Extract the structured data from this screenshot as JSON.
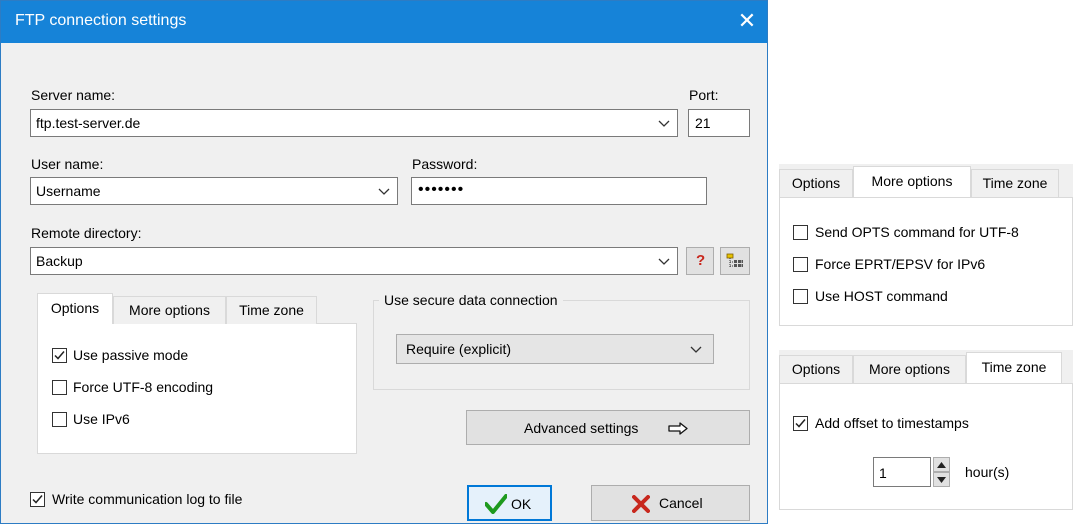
{
  "dialog": {
    "title": "FTP connection settings",
    "close_glyph": "✕",
    "server_label": "Server name:",
    "server_value": "ftp.test-server.de",
    "port_label": "Port:",
    "port_value": "21",
    "user_label": "User name:",
    "user_value": "Username",
    "password_label": "Password:",
    "password_value": "•••••••",
    "remote_label": "Remote directory:",
    "remote_value": "Backup",
    "help_glyph": "?",
    "tabs": [
      "Options",
      "More options",
      "Time zone"
    ],
    "options": [
      {
        "label": "Use passive mode",
        "checked": true
      },
      {
        "label": "Force UTF-8 encoding",
        "checked": false
      },
      {
        "label": "Use IPv6",
        "checked": false
      }
    ],
    "secure_group_label": "Use secure data connection",
    "secure_value": "Require (explicit)",
    "advanced_label": "Advanced settings",
    "log_label": "Write communication log to file",
    "log_checked": true,
    "ok_label": "OK",
    "cancel_label": "Cancel"
  },
  "more_options_panel": {
    "tabs": [
      "Options",
      "More options",
      "Time zone"
    ],
    "items": [
      {
        "label": "Send OPTS command for UTF-8",
        "checked": false
      },
      {
        "label": "Force EPRT/EPSV for IPv6",
        "checked": false
      },
      {
        "label": "Use HOST command",
        "checked": false
      }
    ]
  },
  "time_zone_panel": {
    "tabs": [
      "Options",
      "More options",
      "Time zone"
    ],
    "offset_label": "Add offset to timestamps",
    "offset_checked": true,
    "offset_value": "1",
    "unit_label": "hour(s)"
  },
  "colors": {
    "titlebar": "#1683d8",
    "ok_check": "#1e9a1e",
    "cancel_x": "#c8281e",
    "help": "#c8281e"
  }
}
